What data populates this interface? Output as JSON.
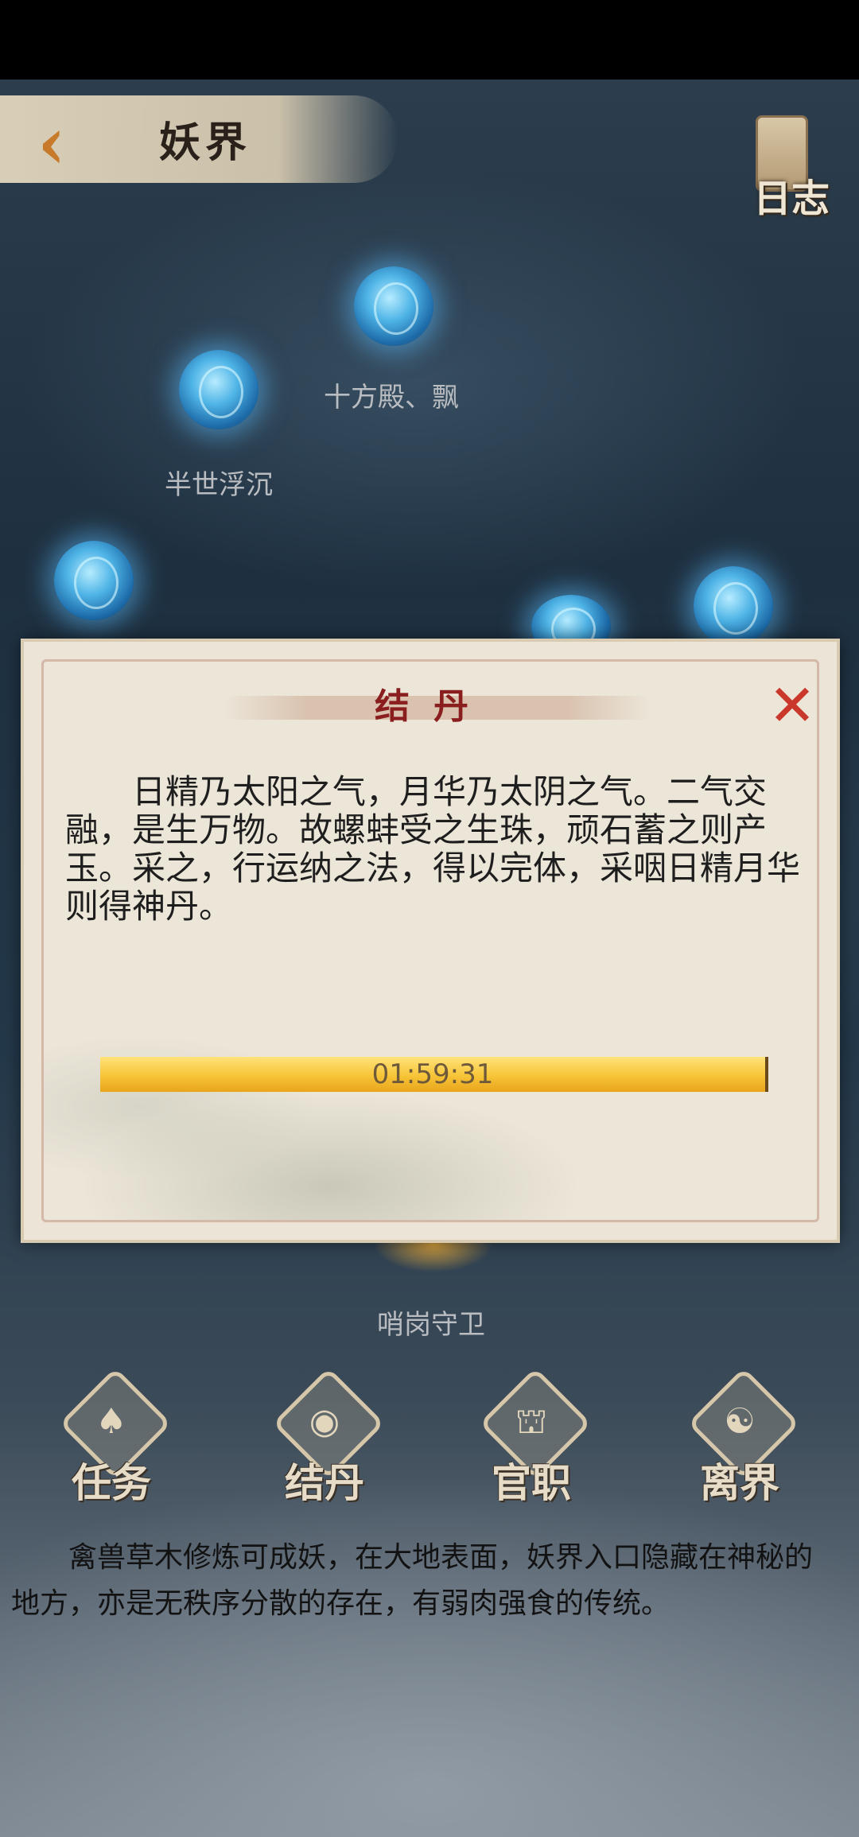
{
  "header": {
    "back_glyph": "‹",
    "title": "妖界",
    "log_label": "日志"
  },
  "orbs": [
    {
      "label": "十方殿、飘"
    },
    {
      "label": "半世浮沉"
    },
    {
      "label": ""
    },
    {
      "label": ""
    },
    {
      "label": ""
    },
    {
      "label": "哨岗守卫"
    }
  ],
  "modal": {
    "title": "结丹",
    "close_glyph": "✕",
    "body": "日精乃太阳之气，月华乃太阴之气。二气交融，是生万物。故螺蚌受之生珠，顽石蓄之则产玉。采之，行运纳之法，得以完体，采咽日精月华则得神丹。",
    "progress": {
      "time": "01:59:31",
      "fraction": 1.0
    }
  },
  "nav": [
    {
      "label": "任务",
      "icon": "flame-icon",
      "glyph": "♠"
    },
    {
      "label": "结丹",
      "icon": "pill-icon",
      "glyph": "◉"
    },
    {
      "label": "官职",
      "icon": "hat-icon",
      "glyph": "⛫"
    },
    {
      "label": "离界",
      "icon": "swirl-icon",
      "glyph": "☯"
    }
  ],
  "footer": {
    "text": "禽兽草木修炼可成妖，在大地表面，妖界入口隐藏在神秘的地方，亦是无秩序分散的存在，有弱肉强食的传统。"
  },
  "colors": {
    "accent": "#8a1e1e",
    "progress": "#f7c437",
    "close": "#c9382a"
  }
}
